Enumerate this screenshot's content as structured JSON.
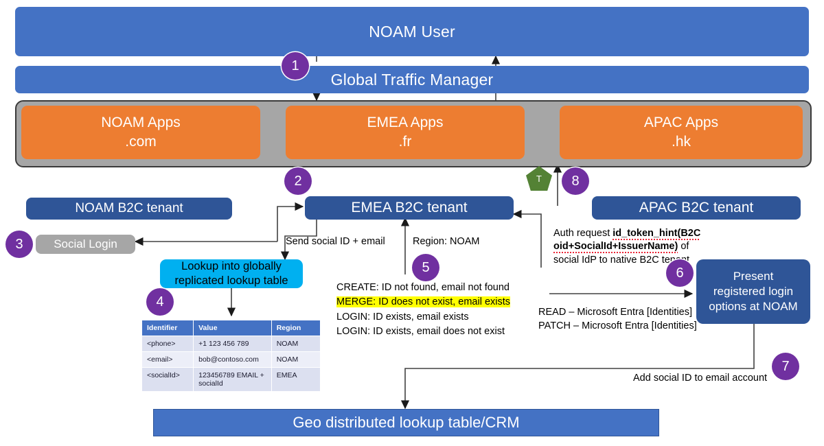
{
  "colors": {
    "blue_bar": "#4472c4",
    "tenant_blue": "#2f5597",
    "orange": "#ed7d31",
    "gray": "#a6a6a6",
    "cyan": "#00b0f0",
    "purple": "#7030a0",
    "green": "#548235",
    "highlight": "#ffff00"
  },
  "top": {
    "user_bar": "NOAM User",
    "traffic_manager": "Global Traffic Manager"
  },
  "apps": [
    {
      "name": "NOAM Apps",
      "domain": ".com"
    },
    {
      "name": "EMEA Apps",
      "domain": ".fr"
    },
    {
      "name": "APAC Apps",
      "domain": ".hk"
    }
  ],
  "tenants": {
    "noam": "NOAM B2C tenant",
    "emea": "EMEA B2C tenant",
    "apac": "APAC B2C tenant"
  },
  "nodes": {
    "social_login": "Social Login",
    "lookup_line1": "Lookup into globally",
    "lookup_line2": "replicated lookup table",
    "present_line1": "Present",
    "present_line2": "registered login",
    "present_line3": "options at NOAM",
    "crm": "Geo distributed lookup table/CRM"
  },
  "marker": {
    "pentagon_label": "T"
  },
  "steps": [
    {
      "n": "1"
    },
    {
      "n": "2"
    },
    {
      "n": "3"
    },
    {
      "n": "4"
    },
    {
      "n": "5"
    },
    {
      "n": "6"
    },
    {
      "n": "7"
    },
    {
      "n": "8"
    }
  ],
  "labels": {
    "send_social": "Send social ID + email",
    "region_noam": "Region: NOAM",
    "rule_create": "CREATE: ID not found, email not found",
    "rule_merge": "MERGE: ID does not exist, email exists",
    "rule_login1": "LOGIN: ID exists, email exists",
    "rule_login2": "LOGIN: ID exists, email does not exist",
    "auth_a": "Auth request ",
    "auth_b": "id_token_hint(B2C",
    "auth_c": "oid+SocialId+IssuerName)",
    "auth_d": " of social",
    "auth_e": "IdP to native B2C tenant",
    "read": "READ – Microsoft Entra [Identities]",
    "patch": "PATCH – Microsoft Entra [Identities]",
    "add_social": "Add social ID to email account"
  },
  "lookup_table": {
    "headers": [
      "Identifier",
      "Value",
      "Region"
    ],
    "rows": [
      [
        "<phone>",
        "+1 123 456 789",
        "NOAM"
      ],
      [
        "<email>",
        "bob@contoso.com",
        "NOAM"
      ],
      [
        "<socialId>",
        "123456789 EMAIL + socialId",
        "EMEA"
      ]
    ]
  }
}
